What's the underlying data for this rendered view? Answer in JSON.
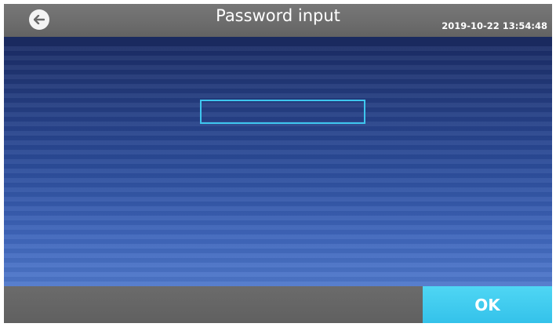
{
  "header": {
    "title": "Password input",
    "datetime": "2019-10-22 13:54:48",
    "back_icon": "arrow-left-icon"
  },
  "password": {
    "value": "",
    "placeholder": ""
  },
  "footer": {
    "ok_label": "OK"
  },
  "colors": {
    "header_bg": "#707070",
    "content_top": "#1a2b63",
    "content_bottom": "#4f78cb",
    "input_border": "#3ec6ee",
    "ok_bg": "#3fcbef",
    "footer_bg": "#666666"
  }
}
